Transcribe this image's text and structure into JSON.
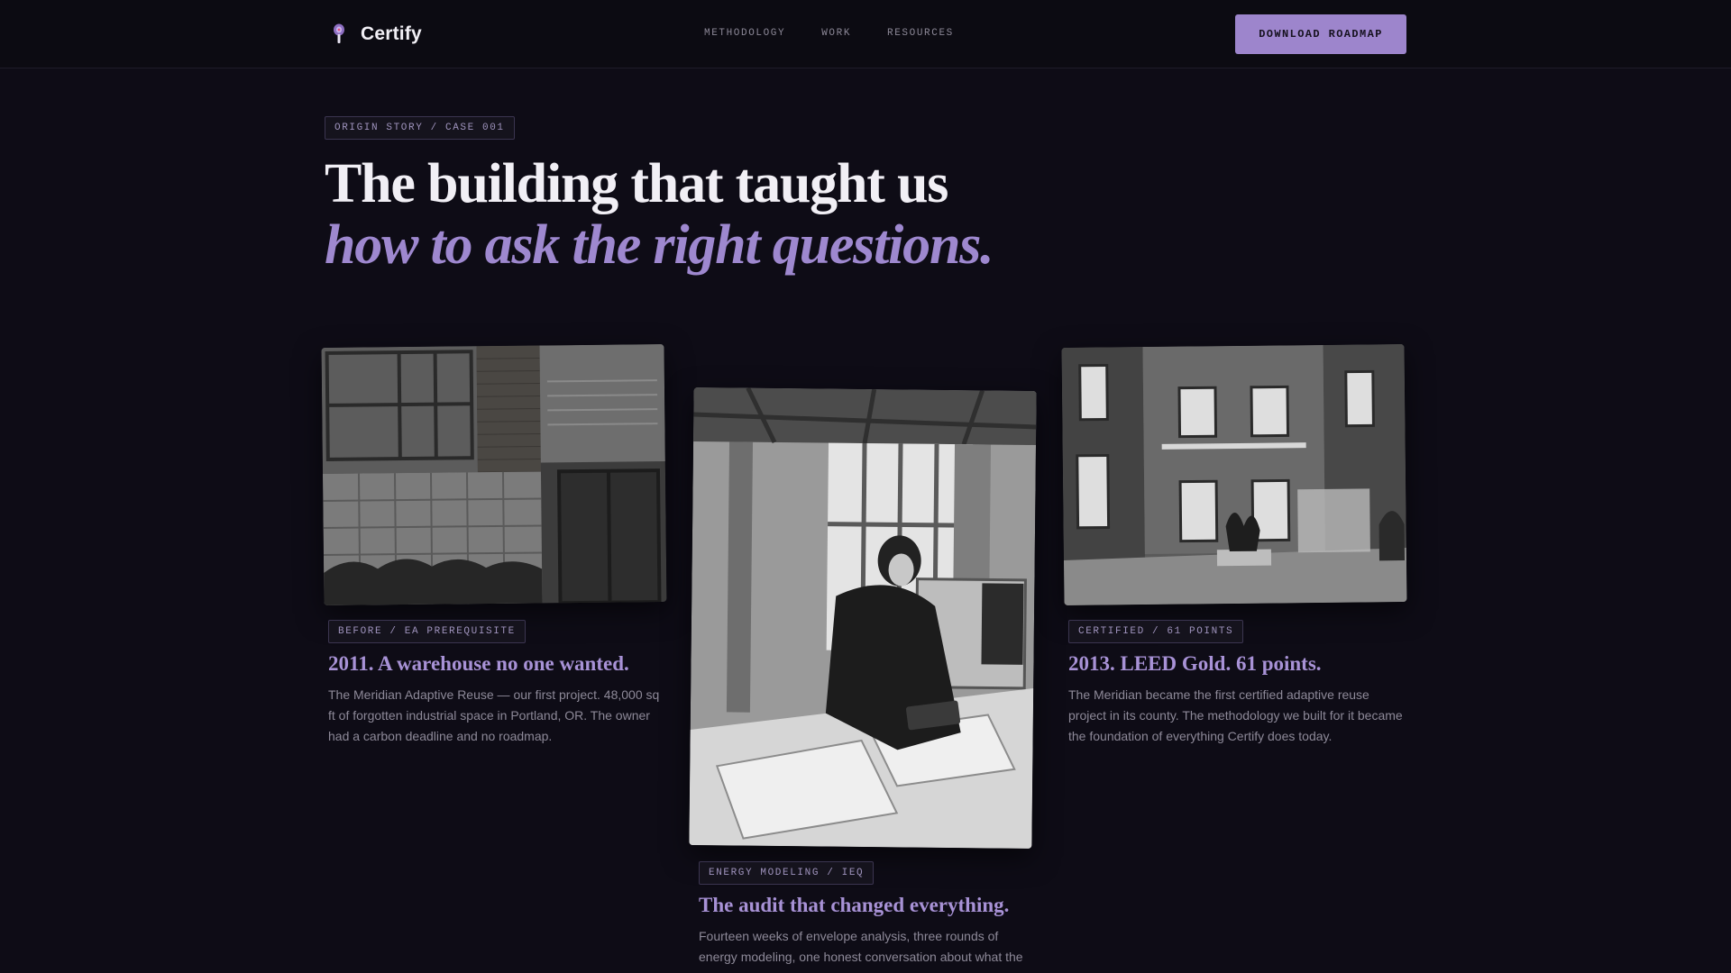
{
  "nav": {
    "brand": "Certify",
    "links": [
      "METHODOLOGY",
      "WORK",
      "RESOURCES"
    ],
    "cta": "DOWNLOAD ROADMAP"
  },
  "hero": {
    "tag": "ORIGIN STORY / CASE 001",
    "line1": "The building that taught us",
    "line2": "how to ask the right questions."
  },
  "cards": [
    {
      "tag": "BEFORE / EA PREREQUISITE",
      "title": "2011. A warehouse no one wanted.",
      "text": "The Meridian Adaptive Reuse — our first project. 48,000 sq ft of forgotten industrial space in Portland, OR. The owner had a carbon deadline and no roadmap.",
      "image": "warehouse-exterior-photo"
    },
    {
      "tag": "ENERGY MODELING / IEQ",
      "title": "The audit that changed everything.",
      "text": "Fourteen weeks of envelope analysis, three rounds of energy modeling, one honest conversation about what the",
      "image": "engineer-reviewing-plans-photo"
    },
    {
      "tag": "CERTIFIED / 61 POINTS",
      "title": "2013. LEED Gold. 61 points.",
      "text": "The Meridian became the first certified adaptive reuse project in its county. The methodology we built for it became the foundation of everything Certify does today.",
      "image": "renovated-loft-interior-photo"
    }
  ],
  "colors": {
    "background": "#0e0c16",
    "accent": "#9d85cc",
    "accent_text": "#a892d6",
    "tag_border": "#3b3550"
  }
}
